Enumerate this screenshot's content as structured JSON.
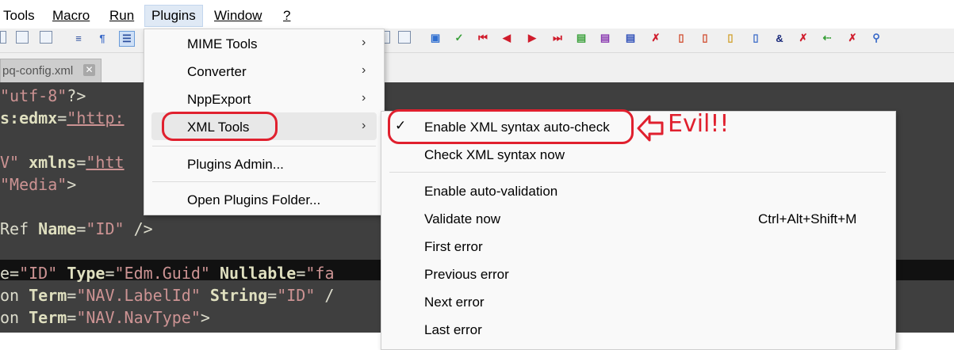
{
  "menubar": {
    "items": [
      "Tools",
      "Macro",
      "Run",
      "Plugins",
      "Window",
      "?"
    ]
  },
  "tab": {
    "filename": "pq-config.xml",
    "close_glyph": "✕"
  },
  "editor": {
    "lines": [
      {
        "parts": [
          {
            "t": "\"utf-8\"",
            "c": "sv"
          },
          {
            "t": "?>",
            "c": ""
          }
        ]
      },
      {
        "parts": [
          {
            "t": "s:edmx",
            "c": "at"
          },
          {
            "t": "=",
            "c": ""
          },
          {
            "t": "\"http:",
            "c": "sv ul"
          }
        ]
      },
      {
        "parts": []
      },
      {
        "parts": [
          {
            "t": "V\" ",
            "c": "sv"
          },
          {
            "t": "xmlns",
            "c": "at"
          },
          {
            "t": "=",
            "c": ""
          },
          {
            "t": "\"htt",
            "c": "sv ul"
          }
        ]
      },
      {
        "parts": [
          {
            "t": "\"Media\"",
            "c": "sv"
          },
          {
            "t": ">",
            "c": ""
          }
        ]
      },
      {
        "parts": []
      },
      {
        "parts": [
          {
            "t": "Ref ",
            "c": ""
          },
          {
            "t": "Name",
            "c": "at"
          },
          {
            "t": "=",
            "c": ""
          },
          {
            "t": "\"ID\"",
            "c": "sv"
          },
          {
            "t": " />",
            "c": ""
          }
        ]
      },
      {
        "parts": []
      },
      {
        "parts": [
          {
            "t": "e",
            "c": ""
          },
          {
            "t": "=",
            "c": ""
          },
          {
            "t": "\"ID\" ",
            "c": "sv"
          },
          {
            "t": "Type",
            "c": "at"
          },
          {
            "t": "=",
            "c": ""
          },
          {
            "t": "\"Edm.Guid\" ",
            "c": "sv"
          },
          {
            "t": "Nullable",
            "c": "at"
          },
          {
            "t": "=",
            "c": ""
          },
          {
            "t": "\"fa",
            "c": "sv"
          }
        ]
      },
      {
        "parts": [
          {
            "t": "on ",
            "c": ""
          },
          {
            "t": "Term",
            "c": "at"
          },
          {
            "t": "=",
            "c": ""
          },
          {
            "t": "\"NAV.LabelId\" ",
            "c": "sv"
          },
          {
            "t": "String",
            "c": "at"
          },
          {
            "t": "=",
            "c": ""
          },
          {
            "t": "\"ID\"",
            "c": "sv"
          },
          {
            "t": " /",
            "c": ""
          }
        ]
      },
      {
        "parts": [
          {
            "t": "on ",
            "c": ""
          },
          {
            "t": "Term",
            "c": "at"
          },
          {
            "t": "=",
            "c": ""
          },
          {
            "t": "\"NAV.NavType\"",
            "c": "sv"
          },
          {
            "t": ">",
            "c": ""
          }
        ]
      }
    ]
  },
  "plugins_menu": {
    "items": [
      {
        "label": "MIME Tools",
        "submenu": true
      },
      {
        "label": "Converter",
        "submenu": true
      },
      {
        "label": "NppExport",
        "submenu": true
      },
      {
        "label": "XML Tools",
        "submenu": true
      },
      {
        "label": "Plugins Admin...",
        "submenu": false
      },
      {
        "label": "Open Plugins Folder...",
        "submenu": false
      }
    ],
    "arrow_glyph": "›"
  },
  "xml_tools_menu": {
    "checkmark": "✓",
    "items": [
      {
        "label": "Enable XML syntax auto-check",
        "checked": true,
        "shortcut": ""
      },
      {
        "label": "Check XML syntax now",
        "checked": false,
        "shortcut": ""
      },
      {
        "label": "Enable auto-validation",
        "checked": false,
        "shortcut": ""
      },
      {
        "label": "Validate now",
        "checked": false,
        "shortcut": "Ctrl+Alt+Shift+M"
      },
      {
        "label": "First error",
        "checked": false,
        "shortcut": ""
      },
      {
        "label": "Previous error",
        "checked": false,
        "shortcut": ""
      },
      {
        "label": "Next error",
        "checked": false,
        "shortcut": ""
      },
      {
        "label": "Last error",
        "checked": false,
        "shortcut": ""
      }
    ]
  },
  "annotation": {
    "arrow_glyph": "⇦",
    "text": "Evil!!"
  },
  "colors": {
    "annotation_red": "#e0202e",
    "editor_bg": "#3f3f3f",
    "string_value": "#cc9393",
    "attribute": "#dfdfbf"
  },
  "toolbar": {
    "icons": [
      "find-in-files-icon",
      "find-icon",
      "wrap-icon",
      "pilcrow-icon",
      "indent-guide-icon",
      "doc-map-icon",
      "record-macro-icon",
      "stop-record-icon",
      "play-macro-icon",
      "play-multiple-icon",
      "save-macro-icon",
      "bookmark-icon",
      "check-icon",
      "first-icon",
      "prev-icon",
      "next-icon",
      "last-icon",
      "validate-icon",
      "schema-icon",
      "xpath-icon",
      "pretty-print-icon",
      "comment-icon",
      "uncomment-icon",
      "ampersand-icon",
      "cross-icon",
      "expand-icon",
      "collapse-icon",
      "options-icon"
    ]
  }
}
